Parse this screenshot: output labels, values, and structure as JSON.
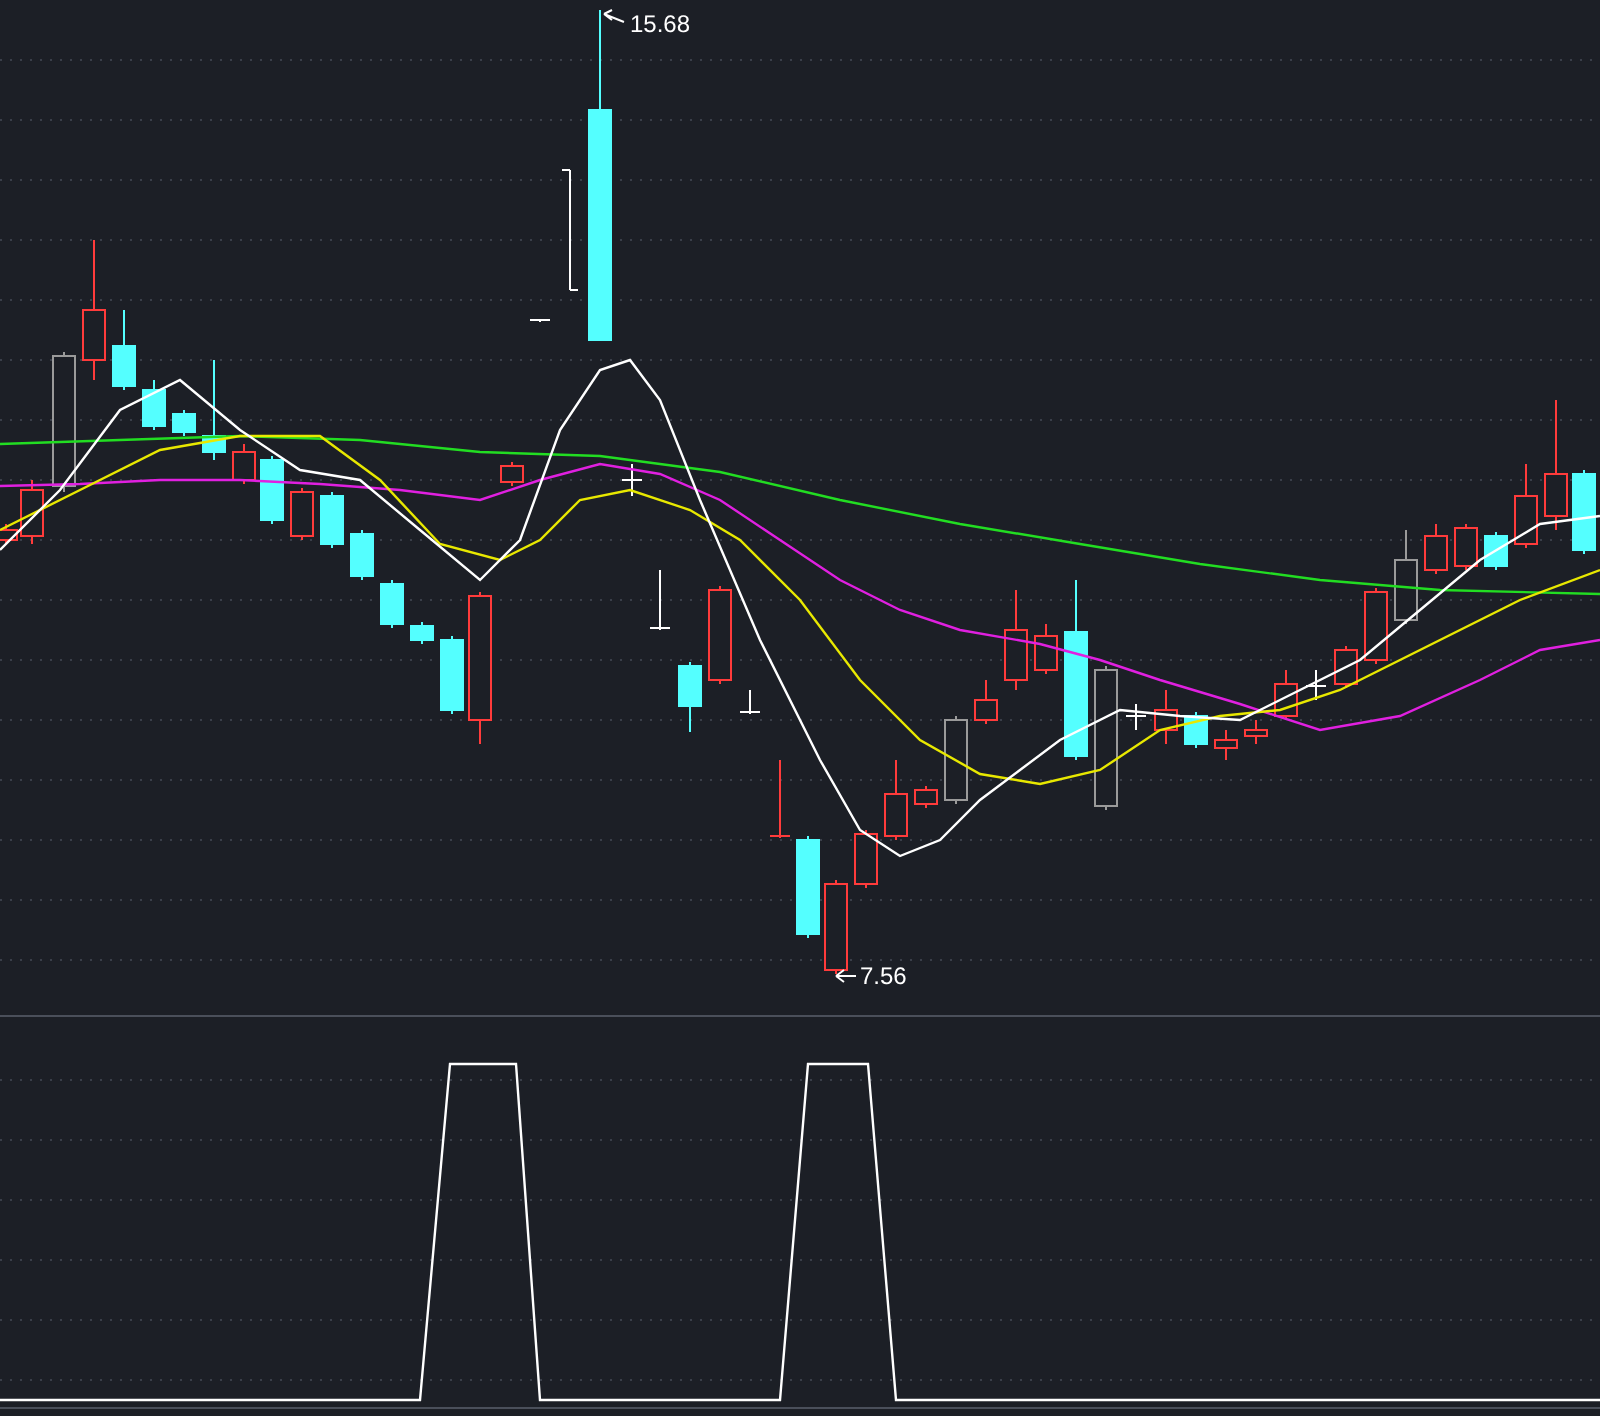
{
  "price_chart": {
    "high_label": "15.68",
    "low_label": "7.56"
  }
}
